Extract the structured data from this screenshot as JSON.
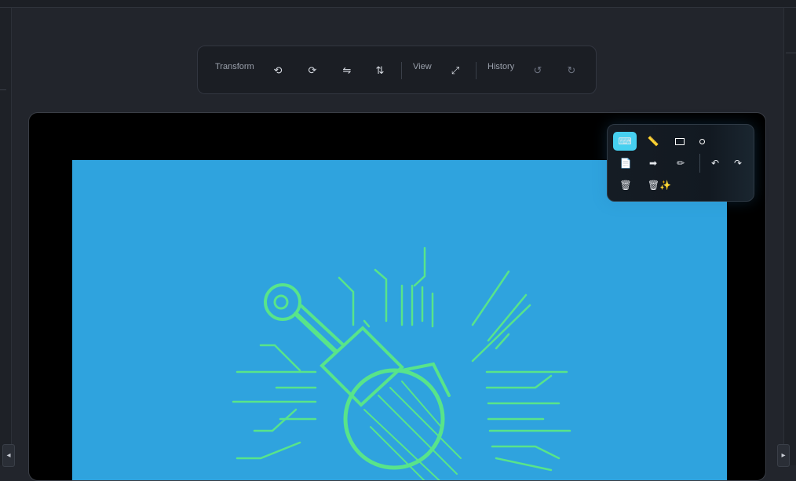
{
  "toolbar": {
    "transform_label": "Transform",
    "view_label": "View",
    "history_label": "History",
    "buttons": {
      "rotate_left": "⟲",
      "rotate_right": "⟳",
      "flip_horizontal": "⇋",
      "flip_vertical": "⇅",
      "fit_view": "⤢",
      "undo": "↺",
      "redo": "↻"
    }
  },
  "draw_panel": {
    "keyboard": "⌨",
    "ruler": "📏",
    "page": "📄",
    "arrow": "➡",
    "pencil": "✏",
    "undo": "↶",
    "redo": "↷",
    "trash": "🗑",
    "trash_clear": "🗑✨"
  },
  "nav": {
    "prev": "◂",
    "next": "▸"
  },
  "colors": {
    "artwork_bg": "#2fa3de",
    "artwork_lines": "#58e48a",
    "active_tool": "#46d0f0"
  }
}
